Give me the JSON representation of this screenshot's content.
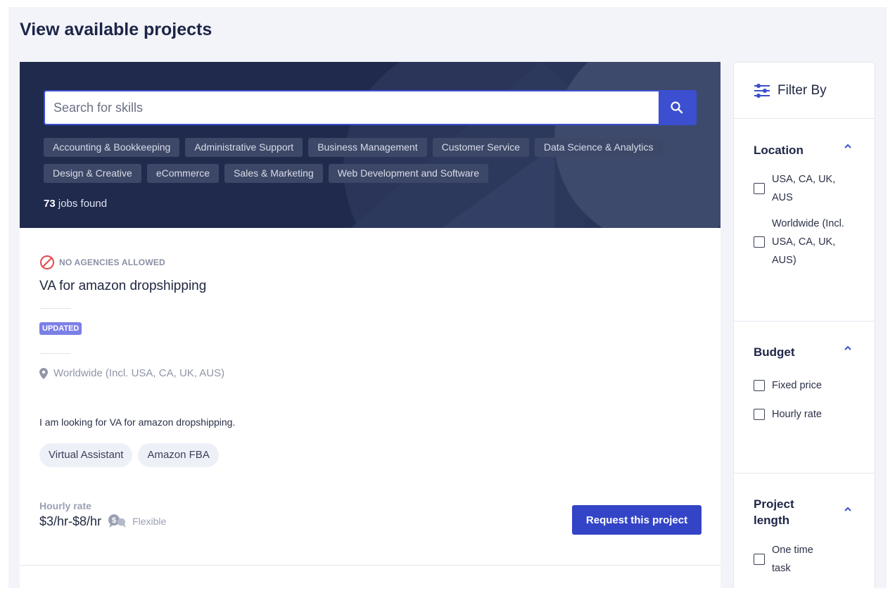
{
  "page": {
    "title": "View available projects"
  },
  "search": {
    "placeholder": "Search for skills",
    "button_icon": "search-icon"
  },
  "categories": [
    "Accounting & Bookkeeping",
    "Administrative Support",
    "Business Management",
    "Customer Service",
    "Data Science & Analytics",
    "Design & Creative",
    "eCommerce",
    "Sales & Marketing",
    "Web Development and Software"
  ],
  "results": {
    "count": "73",
    "suffix": " jobs found"
  },
  "job": {
    "restriction": "NO AGENCIES ALLOWED",
    "restriction_icon": "no-entry-icon",
    "title": "VA for amazon dropshipping",
    "badge": "UPDATED",
    "location_icon": "map-pin-icon",
    "location": "Worldwide (Incl. USA, CA, UK, AUS)",
    "description": "I am looking for VA for amazon dropshipping.",
    "skills": [
      "Virtual Assistant",
      "Amazon FBA"
    ],
    "rate_label": "Hourly rate",
    "rate_value": "$3/hr-$8/hr",
    "negotiable_icon": "negotiate-chat-icon",
    "rate_flex": "Flexible",
    "cta": "Request this project"
  },
  "filters": {
    "title": "Filter By",
    "icon": "sliders-icon",
    "location": {
      "title": "Location",
      "options": [
        "USA, CA, UK, AUS",
        "Worldwide (Incl. USA, CA, UK, AUS)"
      ]
    },
    "budget": {
      "title": "Budget",
      "options": [
        "Fixed price",
        "Hourly rate"
      ]
    },
    "project_length": {
      "title": "Project length",
      "options": [
        "One time task"
      ]
    }
  },
  "colors": {
    "hero_bg": "#1f2a4d",
    "primary": "#3344c6",
    "badge": "#7b7fe6",
    "no_agency": "#e5484d"
  }
}
